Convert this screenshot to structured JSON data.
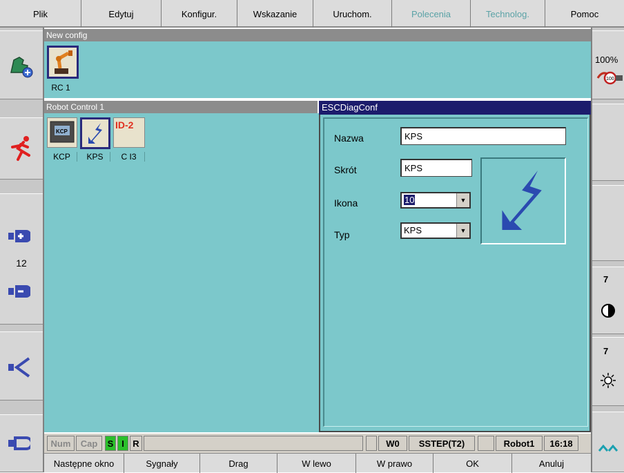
{
  "menu": [
    "Plik",
    "Edytuj",
    "Konfigur.",
    "Wskazanie",
    "Uruchom.",
    "Polecenia",
    "Technolog.",
    "Pomoc"
  ],
  "menu_disabled": [
    false,
    false,
    false,
    false,
    false,
    true,
    true,
    false
  ],
  "config_window": {
    "title": "New config",
    "item_label": "RC 1"
  },
  "robot_panel": {
    "title": "Robot Control 1",
    "items": [
      {
        "label": "KCP"
      },
      {
        "label": "KPS"
      },
      {
        "label": "C I3"
      }
    ],
    "id_badge": "ID-2"
  },
  "dialog": {
    "title": "ESCDiagConf",
    "name_label": "Nazwa",
    "name_value": "KPS",
    "short_label": "Skrót",
    "short_value": "KPS",
    "icon_label": "Ikona",
    "icon_value": "10",
    "type_label": "Typ",
    "type_value": "KPS"
  },
  "left_sidebar": {
    "counter": "12"
  },
  "right_sidebar": {
    "override": "100%",
    "value1": "7",
    "value2": "7"
  },
  "status": {
    "num": "Num",
    "cap": "Cap",
    "s": "S",
    "i": "I",
    "r": "R",
    "w": "W0",
    "step": "SSTEP(T2)",
    "robot": "Robot1",
    "time": "16:18"
  },
  "softkeys": [
    "Następne okno",
    "Sygnały",
    "Drag",
    "W lewo",
    "W prawo",
    "OK",
    "Anuluj"
  ],
  "colors": {
    "teal": "#7cc8cb",
    "dialog_title": "#1c1c6c",
    "status_green": "#2bbf2b"
  }
}
